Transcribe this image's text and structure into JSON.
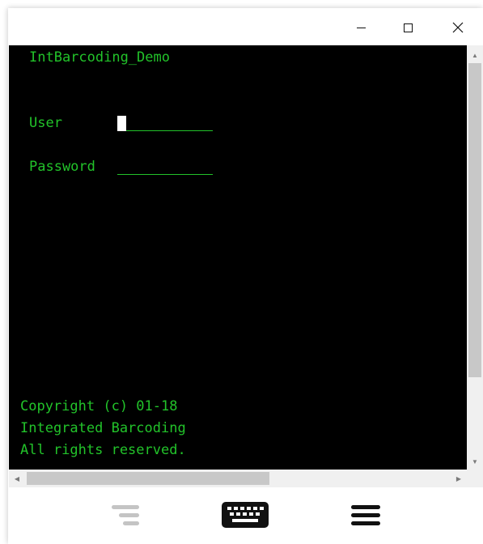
{
  "window": {
    "controls": {
      "minimize_icon": "minimize-icon",
      "maximize_icon": "maximize-icon",
      "close_icon": "close-icon"
    }
  },
  "terminal": {
    "app_title": "IntBarcoding_Demo",
    "user_label": "User",
    "password_label": "Password",
    "user_value": "",
    "password_value": "",
    "footer": [
      "Copyright (c) 01-18",
      "Integrated Barcoding",
      "All rights reserved."
    ],
    "colors": {
      "background": "#000000",
      "text": "#22c32a",
      "cursor": "#ffffff"
    }
  },
  "scrollbars": {
    "vertical": {
      "up_arrow": "▲",
      "down_arrow": "▼"
    },
    "horizontal": {
      "left_arrow": "◀",
      "right_arrow": "▶"
    }
  },
  "toolbar": {
    "nav_icon": "nav-lines-icon",
    "keyboard_icon": "keyboard-icon",
    "menu_icon": "hamburger-menu-icon"
  }
}
